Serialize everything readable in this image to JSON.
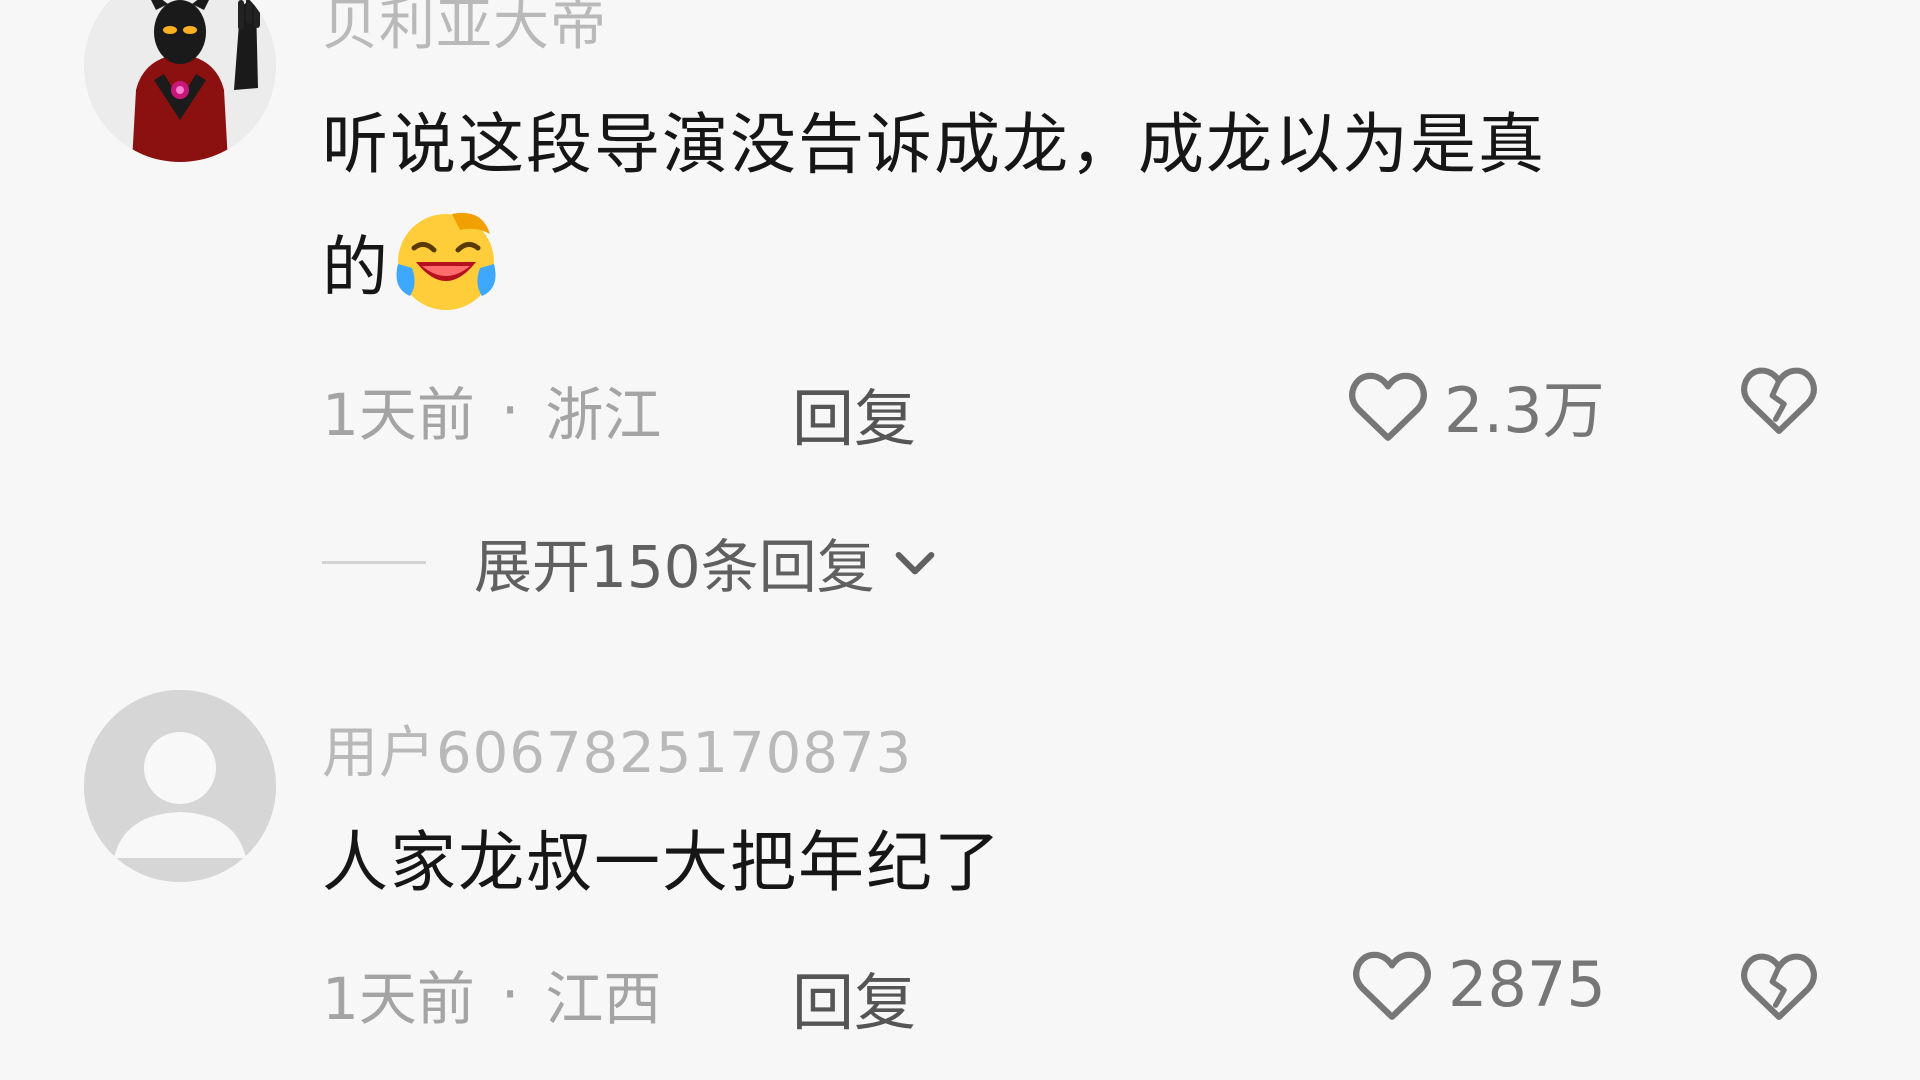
{
  "comments": [
    {
      "username": "贝利亚大帝",
      "text_line1": "听说这段导演没告诉成龙，成龙以为是真",
      "text_line2": "的",
      "time": "1天前",
      "separator": "·",
      "location": "浙江",
      "reply_label": "回复",
      "likes": "2.3万",
      "avatar_icon": "dark-red-hero-avatar",
      "emoji_icon": "laughing-crying-face-icon"
    },
    {
      "username": "用户6067825170873",
      "text_line1": "人家龙叔一大把年纪了",
      "time": "1天前",
      "separator": "·",
      "location": "江西",
      "reply_label": "回复",
      "likes": "2875",
      "avatar_icon": "default-user-avatar"
    }
  ],
  "expand_replies": {
    "label": "展开150条回复"
  },
  "colors": {
    "background": "#f7f7f7",
    "text": "#161616",
    "muted": "#a4a4a4",
    "icon": "#777777"
  }
}
